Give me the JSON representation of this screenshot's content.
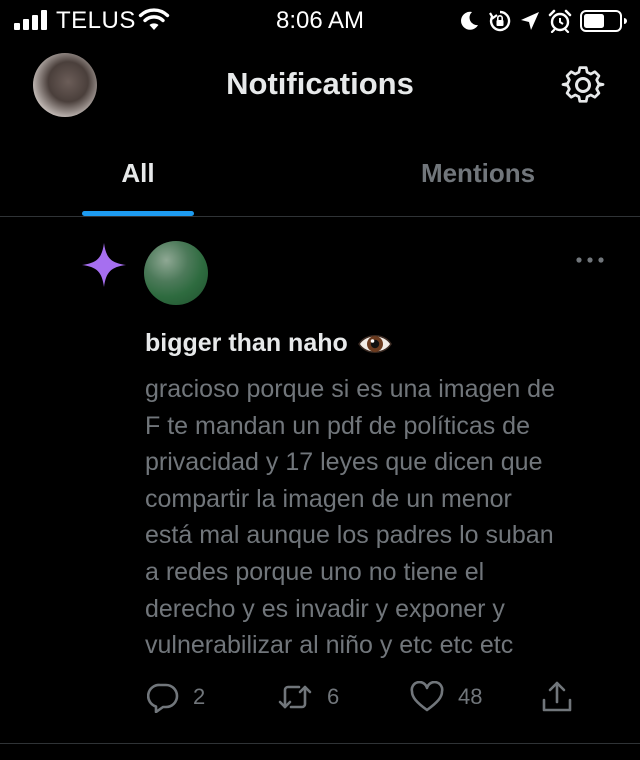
{
  "status_bar": {
    "carrier": "TELUS",
    "time": "8:06 AM",
    "icons": [
      "signal-icon",
      "wifi-icon",
      "moon-icon",
      "orientation-lock-icon",
      "location-icon",
      "alarm-icon",
      "battery-icon"
    ]
  },
  "header": {
    "title": "Notifications",
    "avatar_icon": "profile-avatar",
    "settings_icon": "gear-icon"
  },
  "tabs": [
    {
      "label": "All",
      "active": true
    },
    {
      "label": "Mentions",
      "active": false
    }
  ],
  "notification": {
    "type_icon": "sparkle-icon",
    "author": "bigger than naho",
    "author_emoji": "eye-emoji",
    "text": "gracioso porque si es una imagen de\nF te mandan un pdf de políticas de\nprivacidad y 17 leyes que dicen que\ncompartir la imagen de un menor\nestá mal aunque los padres lo suban\na redes porque uno no tiene el\nderecho y es invadir y exponer y\nvulnerabilizar al niño y etc etc etc",
    "actions": {
      "replies": "2",
      "retweets": "6",
      "likes": "48"
    }
  },
  "colors": {
    "background": "#000000",
    "text_primary": "#e7e9ea",
    "text_secondary": "#71767b",
    "accent_blue": "#1d9bf0",
    "sparkle_purple": "#a66ff0",
    "divider": "#2f3336"
  }
}
